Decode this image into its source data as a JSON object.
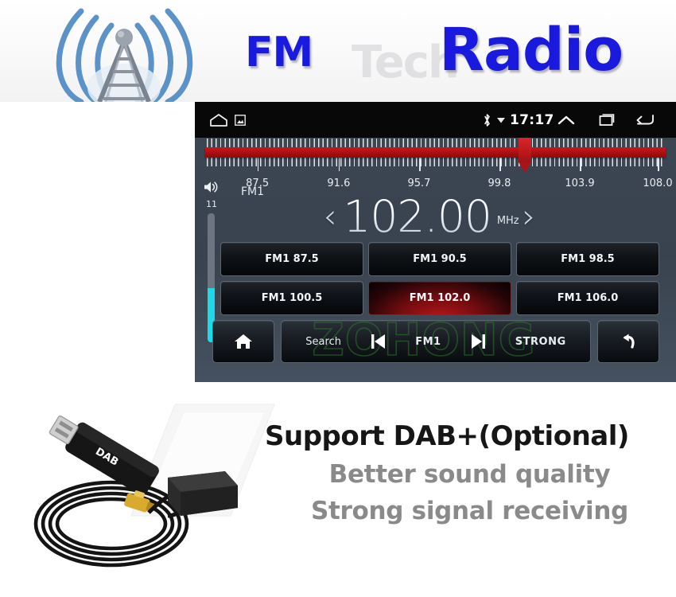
{
  "banner": {
    "fm_text": "FM",
    "radio_text": "Radio",
    "watermark_text": "Tech",
    "tower_icon": "radio-tower-icon",
    "blue_color": "#1a1adf"
  },
  "radio_panel": {
    "statusbar": {
      "home_icon": "home-outline-icon",
      "screenshot_icon": "screenshot-icon",
      "bluetooth_icon": "bluetooth-icon",
      "dropdown_icon": "caret-down-icon",
      "clock": "17:17",
      "expand_icon": "chevron-up-icon",
      "recents_icon": "recent-apps-icon",
      "back_icon": "back-arrow-icon"
    },
    "tuner": {
      "needle_icon": "tuner-needle-icon",
      "needle_position_pct": 68.6,
      "labels": [
        "87.5",
        "91.6",
        "95.7",
        "99.8",
        "103.9",
        "108.0"
      ],
      "label_positions_pct": [
        13.0,
        29.9,
        46.6,
        63.3,
        80.0,
        96.2
      ],
      "bar_color": "#b00f12"
    },
    "volume": {
      "icon": "speaker-volume-icon",
      "value": "11",
      "fill_pct": 42,
      "fill_color": "#1fd8e8"
    },
    "band_label": "FM1",
    "frequency": {
      "prev_arrow": "‹",
      "value": "102.00",
      "unit": "MHz",
      "next_arrow": "›"
    },
    "presets": [
      {
        "label": "FM1 87.5",
        "active": false
      },
      {
        "label": "FM1 90.5",
        "active": false
      },
      {
        "label": "FM1 98.5",
        "active": false
      },
      {
        "label": "FM1 100.5",
        "active": false
      },
      {
        "label": "FM1 102.0",
        "active": true
      },
      {
        "label": "FM1 106.0",
        "active": false
      }
    ],
    "controls": {
      "home_icon": "home-filled-icon",
      "search_label": "Search",
      "prev_icon": "previous-track-icon",
      "band_label": "FM1",
      "next_icon": "next-track-icon",
      "strong_label": "STRONG",
      "back_icon": "return-arrow-icon"
    },
    "watermark": "ZOHONG"
  },
  "bottom": {
    "dongle_icon": "usb-dab-dongle-antenna-image",
    "title": "Support DAB+(Optional)",
    "subtitles": [
      "Better sound quality",
      "Strong signal receiving"
    ]
  }
}
